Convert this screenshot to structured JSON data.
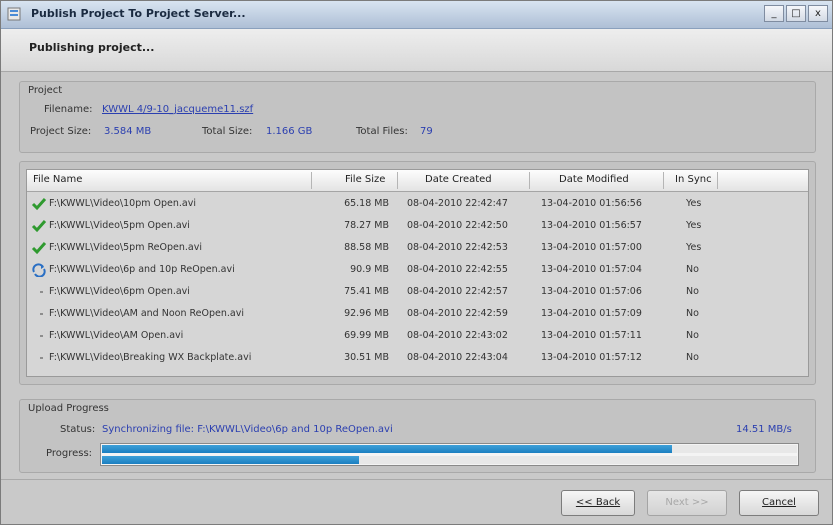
{
  "window": {
    "title": "Publish Project To Project Server...",
    "controls": [
      "_",
      "□",
      "x"
    ]
  },
  "header": {
    "title": "Publishing project..."
  },
  "project": {
    "group_title": "Project",
    "filename_label": "Filename:",
    "filename_value": "KWWL 4/9-10_jacqueme11.szf",
    "size_label": "Project Size:",
    "size_value": "3.584 MB",
    "total_size_label": "Total Size:",
    "total_size_value": "1.166 GB",
    "total_files_label": "Total Files:",
    "total_files_value": "79"
  },
  "table": {
    "columns": [
      "File Name",
      "File Size",
      "Date Created",
      "Date Modified",
      "In Sync"
    ],
    "rows": [
      {
        "icon": "check-icon",
        "name": "F:\\KWWL\\Video\\10pm Open.avi",
        "size": "65.18 MB",
        "created": "08-04-2010 22:42:47",
        "modified": "13-04-2010 01:56:56",
        "sync": "Yes"
      },
      {
        "icon": "check-icon",
        "name": "F:\\KWWL\\Video\\5pm Open.avi",
        "size": "78.27 MB",
        "created": "08-04-2010 22:42:50",
        "modified": "13-04-2010 01:56:57",
        "sync": "Yes"
      },
      {
        "icon": "check-icon",
        "name": "F:\\KWWL\\Video\\5pm ReOpen.avi",
        "size": "88.58 MB",
        "created": "08-04-2010 22:42:53",
        "modified": "13-04-2010 01:57:00",
        "sync": "Yes"
      },
      {
        "icon": "sync-icon",
        "name": "F:\\KWWL\\Video\\6p and 10p ReOpen.avi",
        "size": "90.9 MB",
        "created": "08-04-2010 22:42:55",
        "modified": "13-04-2010 01:57:04",
        "sync": "No"
      },
      {
        "icon": "dash-icon",
        "name": "F:\\KWWL\\Video\\6pm Open.avi",
        "size": "75.41 MB",
        "created": "08-04-2010 22:42:57",
        "modified": "13-04-2010 01:57:06",
        "sync": "No"
      },
      {
        "icon": "dash-icon",
        "name": "F:\\KWWL\\Video\\AM and Noon ReOpen.avi",
        "size": "92.96 MB",
        "created": "08-04-2010 22:42:59",
        "modified": "13-04-2010 01:57:09",
        "sync": "No"
      },
      {
        "icon": "dash-icon",
        "name": "F:\\KWWL\\Video\\AM Open.avi",
        "size": "69.99 MB",
        "created": "08-04-2010 22:43:02",
        "modified": "13-04-2010 01:57:11",
        "sync": "No"
      },
      {
        "icon": "dash-icon",
        "name": "F:\\KWWL\\Video\\Breaking WX Backplate.avi",
        "size": "30.51 MB",
        "created": "08-04-2010 22:43:04",
        "modified": "13-04-2010 01:57:12",
        "sync": "No"
      }
    ]
  },
  "upload": {
    "group_title": "Upload Progress",
    "status_label": "Status:",
    "status_value": "Synchronizing file: F:\\KWWL\\Video\\6p and 10p ReOpen.avi",
    "speed": "14.51 MB/s",
    "progress_label": "Progress:",
    "file_progress": 0.82,
    "total_progress": 0.37
  },
  "buttons": {
    "back": "<< Back",
    "next": "Next >>",
    "cancel": "Cancel"
  },
  "colors": {
    "link": "#2b3fb0",
    "progress": "#1b7fc0",
    "check": "#2f9a2f"
  }
}
